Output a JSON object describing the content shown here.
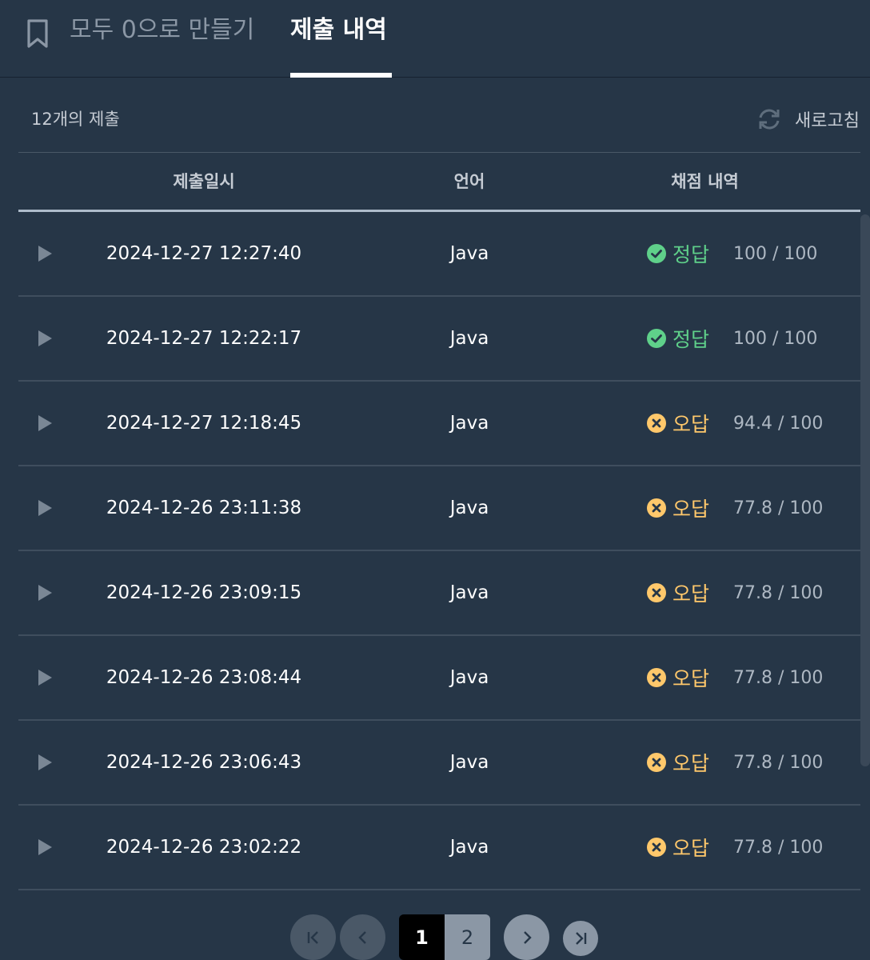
{
  "tabs": {
    "problem_title": "모두 0으로 만들기",
    "history_label": "제출 내역"
  },
  "summary": {
    "count_text": "12개의 제출",
    "refresh_label": "새로고침"
  },
  "table": {
    "headers": {
      "date": "제출일시",
      "language": "언어",
      "result": "채점 내역"
    },
    "rows": [
      {
        "date": "2024-12-27 12:27:40",
        "language": "Java",
        "status": "정답",
        "status_type": "correct",
        "score": "100 / 100"
      },
      {
        "date": "2024-12-27 12:22:17",
        "language": "Java",
        "status": "정답",
        "status_type": "correct",
        "score": "100 / 100"
      },
      {
        "date": "2024-12-27 12:18:45",
        "language": "Java",
        "status": "오답",
        "status_type": "wrong",
        "score": "94.4 / 100"
      },
      {
        "date": "2024-12-26 23:11:38",
        "language": "Java",
        "status": "오답",
        "status_type": "wrong",
        "score": "77.8 / 100"
      },
      {
        "date": "2024-12-26 23:09:15",
        "language": "Java",
        "status": "오답",
        "status_type": "wrong",
        "score": "77.8 / 100"
      },
      {
        "date": "2024-12-26 23:08:44",
        "language": "Java",
        "status": "오답",
        "status_type": "wrong",
        "score": "77.8 / 100"
      },
      {
        "date": "2024-12-26 23:06:43",
        "language": "Java",
        "status": "오답",
        "status_type": "wrong",
        "score": "77.8 / 100"
      },
      {
        "date": "2024-12-26 23:02:22",
        "language": "Java",
        "status": "오답",
        "status_type": "wrong",
        "score": "77.8 / 100"
      }
    ]
  },
  "pagination": {
    "pages": [
      "1",
      "2"
    ],
    "current": "1"
  },
  "colors": {
    "background": "#263647",
    "correct": "#5fd08a",
    "wrong": "#ffc86b",
    "muted": "#aeb8c3"
  }
}
